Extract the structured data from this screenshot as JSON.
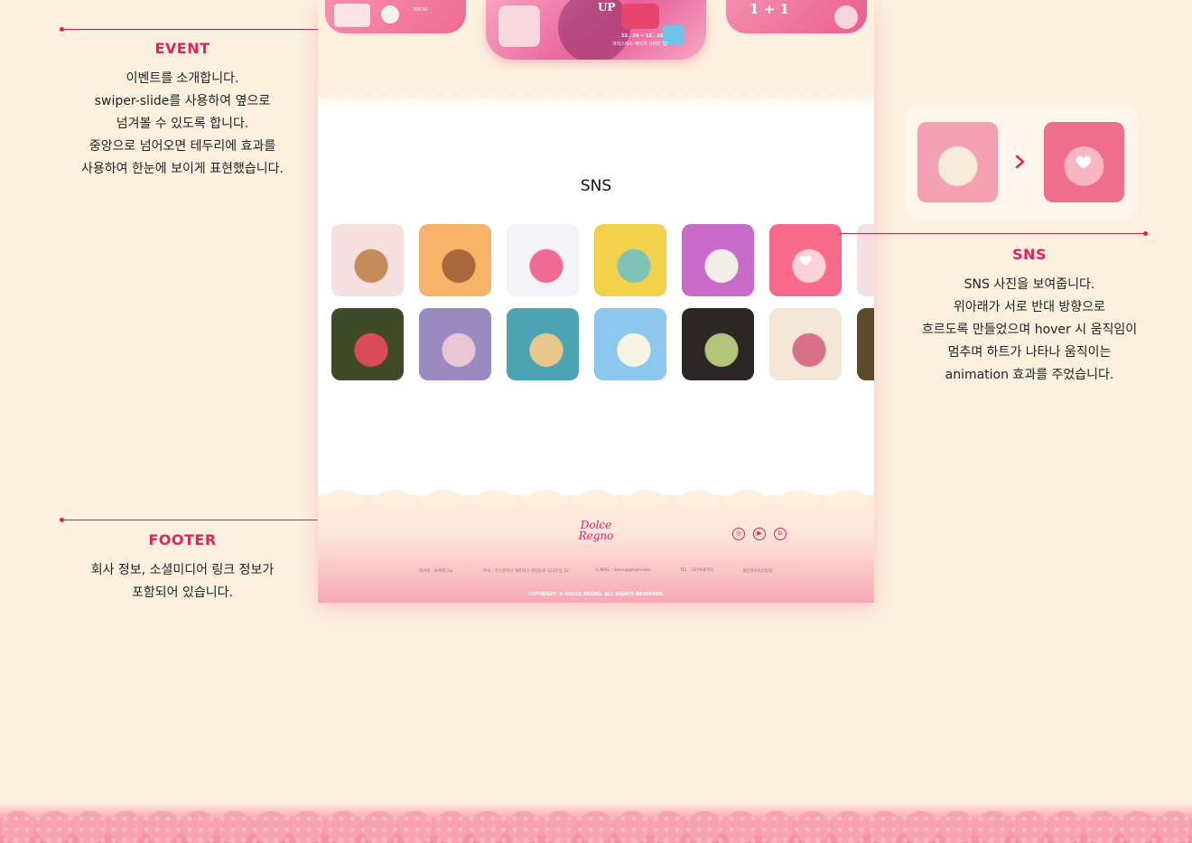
{
  "annotations": {
    "event": {
      "title": "EVENT",
      "lines": [
        "이벤트를 소개합니다.",
        "swiper-slide를 사용하여 옆으로",
        "넘겨볼 수 있도록 합니다.",
        "중앙으로 넘어오면 테두리에 효과를",
        "사용하여 한눈에 보이게 표현했습니다."
      ]
    },
    "sns": {
      "title": "SNS",
      "lines": [
        "SNS 사진을 보여줍니다.",
        "위아래가 서로 반대 방향으로",
        "흐르도록 만들었으며 hover 시 움직임이",
        "멈추며 하트가 나타나 움직이는",
        "animation 효과를 주었습니다."
      ]
    },
    "footer": {
      "title": "FOOTER",
      "lines": [
        "회사 정보, 소셜미디어 링크 정보가",
        "포함되어 있습니다."
      ]
    }
  },
  "mockup": {
    "events": {
      "card_left_text": "SNOW",
      "card_center_text": "UP",
      "card_center_date": "12 . 24 ~ 12 . 25",
      "card_center_sub": "크리스마스 케이크 사이즈 업!",
      "card_right_text": "1 + 1"
    },
    "sns_section": {
      "heading": "SNS",
      "row1": [
        {
          "icon": "sundae-cone-photo",
          "colors": [
            "#f6dfe0",
            "#c58b5a"
          ]
        },
        {
          "icon": "cookie-scoops-photo",
          "colors": [
            "#f7b36a",
            "#a8683a"
          ]
        },
        {
          "icon": "pink-cone-photo",
          "colors": [
            "#f4f4f8",
            "#f06a94"
          ]
        },
        {
          "icon": "gelato-trays-photo",
          "colors": [
            "#f2d24a",
            "#7fc3b8"
          ]
        },
        {
          "icon": "cookies-cream-cup-photo",
          "colors": [
            "#c86ac8",
            "#f2efe8"
          ]
        },
        {
          "icon": "strawberry-scoop-photo",
          "colors": [
            "#ef6c8a",
            "#f9d2d8"
          ],
          "hovered": true
        },
        {
          "icon": "partial-photo",
          "colors": [
            "#f6dfe0",
            "#e9a9b3"
          ]
        }
      ],
      "row2": [
        {
          "icon": "berries-table-photo",
          "colors": [
            "#3e4a2a",
            "#d94b5a"
          ]
        },
        {
          "icon": "strawberry-cones-photo",
          "colors": [
            "#9a8ac0",
            "#e9c6d6"
          ]
        },
        {
          "icon": "hands-cones-photo",
          "colors": [
            "#4aa4b4",
            "#e8c88a"
          ]
        },
        {
          "icon": "vanilla-bowl-photo",
          "colors": [
            "#8cc7ee",
            "#f5f3e4"
          ]
        },
        {
          "icon": "pistachio-cone-photo",
          "colors": [
            "#2b2624",
            "#b3c57a"
          ]
        },
        {
          "icon": "gelato-tubs-photo",
          "colors": [
            "#f4e7d8",
            "#d9708a"
          ]
        },
        {
          "icon": "partial-photo",
          "colors": [
            "#5b4a2a",
            "#e5c37a"
          ]
        }
      ]
    },
    "footer": {
      "logo_line1": "Dolce",
      "logo_line2": "Regno",
      "company": "회사명 : 돌체레그노",
      "address": "주소 : 부산광역시 해운대구 센텀동로 123번길 22",
      "email": "E-MAIL : dolce@gmail.com",
      "tel": "TEL : 1574-8765",
      "privacy": "개인정보처리방침",
      "copyright": "COPYRIGHT © DOLCE REGNO. ALL RIGHTS RESERVED.",
      "social": [
        "instagram-icon",
        "youtube-icon",
        "blog-icon"
      ]
    }
  },
  "hover_preview": {
    "before_colors": [
      "#f3a0b3",
      "#f7ecd8"
    ],
    "after_colors": [
      "#ee6f8c",
      "#f7b6c2"
    ]
  },
  "colors": {
    "accent": "#e0245e",
    "background": "#fdf0df",
    "lace_pink": "#f9a3b1"
  }
}
